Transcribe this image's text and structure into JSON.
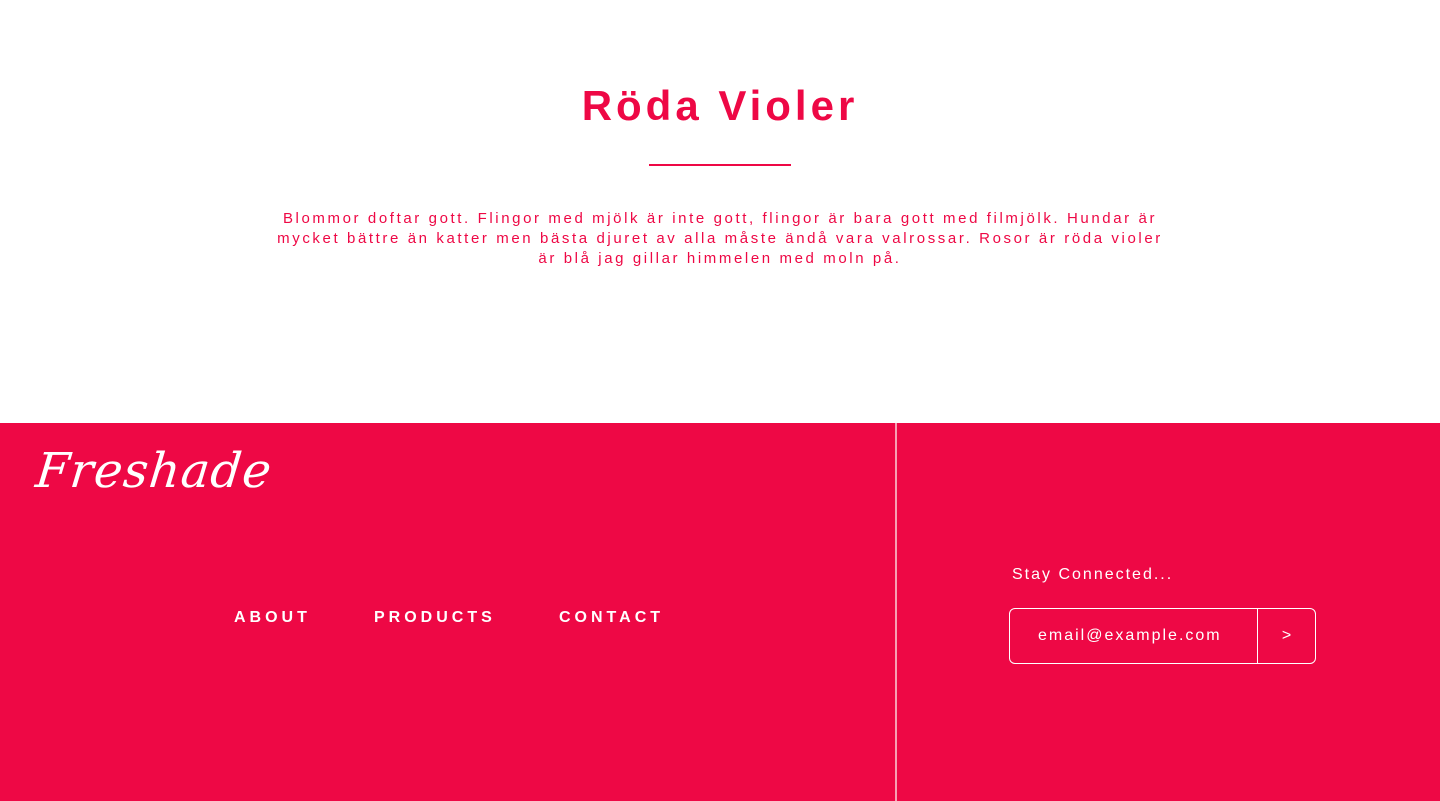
{
  "colors": {
    "accent": "#ee0845",
    "background": "#ffffff",
    "footer_text": "#ffffff"
  },
  "hero": {
    "title": "Röda Violer",
    "text": "Blommor doftar gott. Flingor med mjölk är inte gott, flingor är bara gott med filmjölk. Hundar är mycket bättre än katter men bästa djuret av alla måste ändå vara valrossar. Rosor är röda violer är blå jag gillar himmelen med moln på."
  },
  "footer": {
    "brand": "Freshade",
    "nav": {
      "about": "ABOUT",
      "products": "PRODUCTS",
      "contact": "CONTACT"
    },
    "subscribe": {
      "heading": "Stay Connected...",
      "placeholder": "email@example.com",
      "submit_label": ">"
    }
  }
}
